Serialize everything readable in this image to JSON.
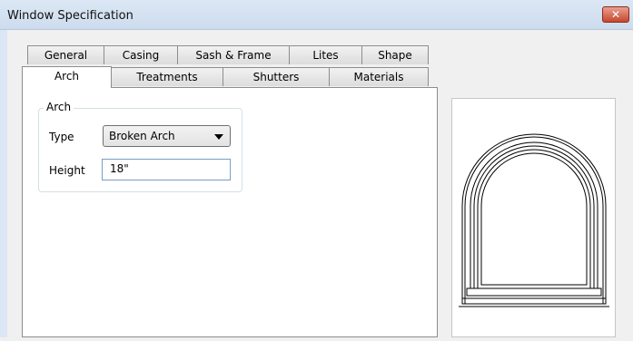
{
  "window": {
    "title": "Window Specification",
    "close_label": "x"
  },
  "tabs": {
    "row1": [
      "General",
      "Casing",
      "Sash & Frame",
      "Lites",
      "Shape"
    ],
    "row2": [
      "Arch",
      "Treatments",
      "Shutters",
      "Materials"
    ],
    "active": "Arch"
  },
  "arch_group": {
    "label": "Arch",
    "type_label": "Type",
    "type_value": "Broken Arch",
    "height_label": "Height",
    "height_value": "18\""
  }
}
